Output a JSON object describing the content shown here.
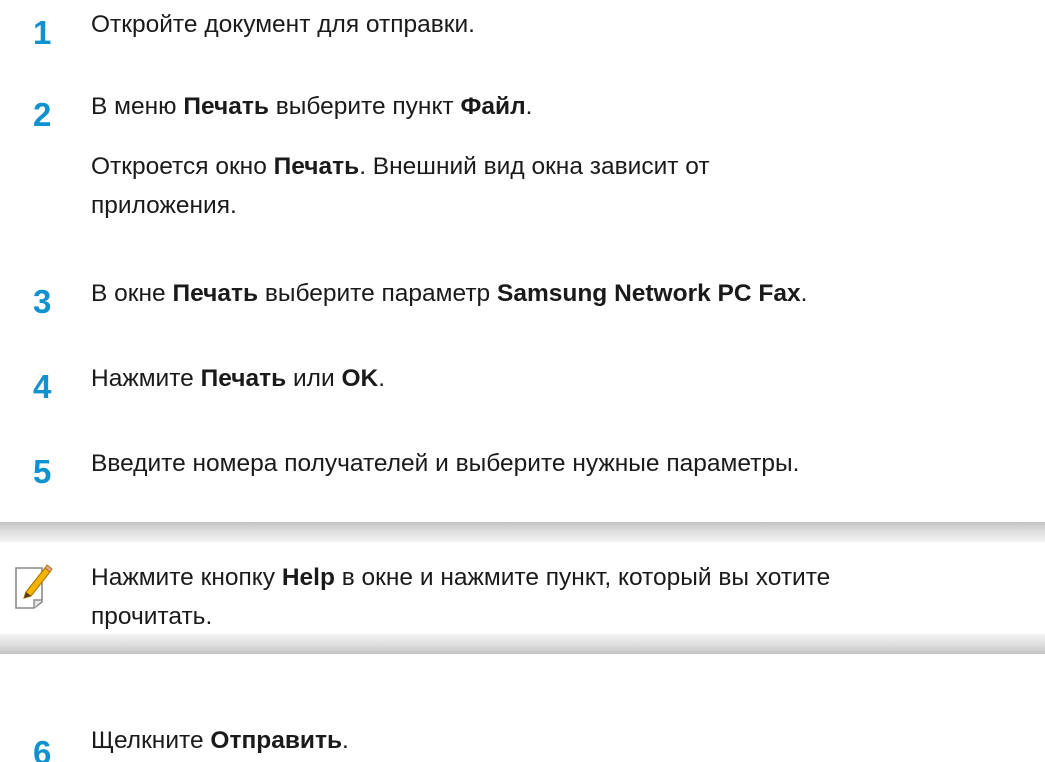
{
  "steps": [
    {
      "number": "1",
      "line1": {
        "p1": "Откройте документ для отправки.",
        "b1": "",
        "p2": "",
        "b2": "",
        "p3": ""
      }
    },
    {
      "number": "2",
      "line1": {
        "p1": "В меню ",
        "b1": "Печать",
        "p2": " выберите пункт ",
        "b2": "Файл",
        "p3": "."
      },
      "line2": {
        "p1": "Откроется окно ",
        "b1": "Печать",
        "p2": ". Внешний вид окна зависит от"
      },
      "line3": "приложения."
    },
    {
      "number": "3",
      "line1": {
        "p1": "В окне ",
        "b1": "Печать",
        "p2": " выберите параметр ",
        "b2": "Samsung Network PC Fax",
        "p3": "."
      }
    },
    {
      "number": "4",
      "line1": {
        "p1": "Нажмите ",
        "b1": "Печать",
        "p2": " или ",
        "b2": "OK",
        "p3": "."
      }
    },
    {
      "number": "5",
      "line1": {
        "p1": "Введите номера получателей и выберите нужные параметры.",
        "b1": "",
        "p2": "",
        "b2": "",
        "p3": ""
      }
    },
    {
      "number": "6",
      "line1": {
        "p1": "Щелкните ",
        "b1": "Отправить",
        "p2": ".",
        "b2": "",
        "p3": ""
      }
    }
  ],
  "note": {
    "icon": "note-pencil-icon",
    "p1": "Нажмите кнопку ",
    "b1": "Help",
    "p2": " в окне и нажмите пункт, который вы хотите",
    "line2": "прочитать."
  },
  "colors": {
    "step_number": "#0f92cf",
    "text": "#1a1a1a",
    "note_band": "#c8c8c8"
  }
}
